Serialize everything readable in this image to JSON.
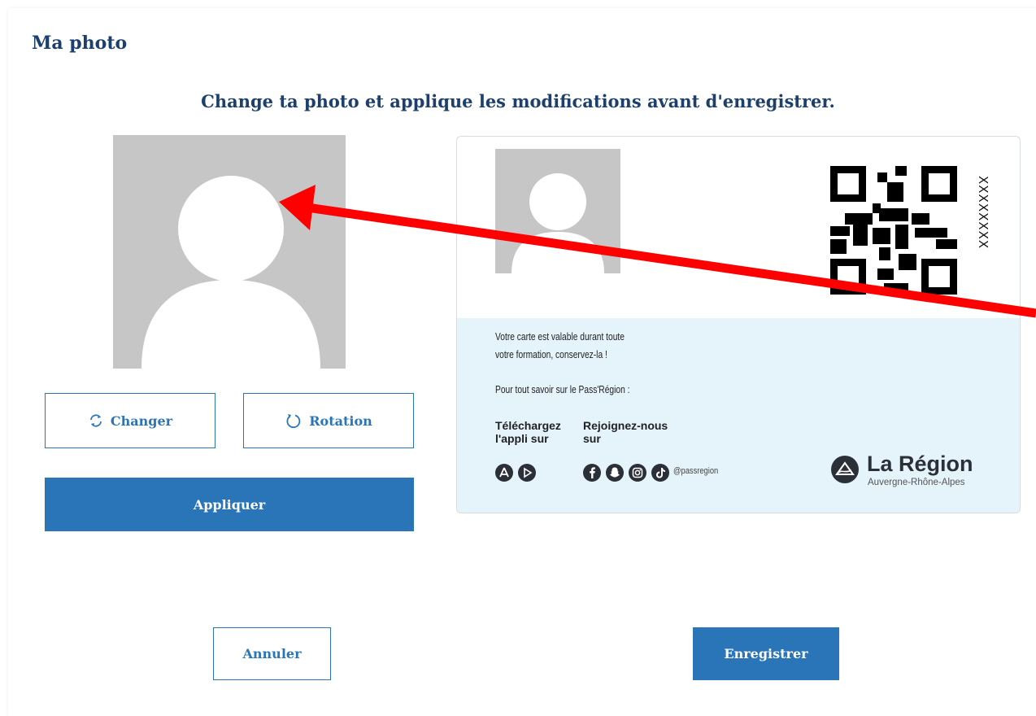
{
  "page": {
    "title": "Ma photo",
    "subtitle": "Change ta photo et applique les modifications avant d'enregistrer."
  },
  "photo_editor": {
    "change_label": "Changer",
    "rotation_label": "Rotation",
    "apply_label": "Appliquer"
  },
  "card": {
    "id_number": "XXXXXXXX",
    "validity_line1": "Votre carte est valable durant toute",
    "validity_line2": "votre formation, conservez-la !",
    "info_text": "Pour tout savoir sur le Pass'Région :",
    "download_line1": "Téléchargez",
    "download_line2": "l'appli sur",
    "join_line1": "Rejoignez-nous",
    "join_line2": "sur",
    "social_handle": "@passregion",
    "brand_name": "La Région",
    "brand_sub": "Auvergne-Rhône-Alpes"
  },
  "footer": {
    "cancel_label": "Annuler",
    "save_label": "Enregistrer"
  },
  "colors": {
    "primary": "#2a74b8",
    "title": "#1c3f6e",
    "card_bottom": "#e5f3fb",
    "placeholder": "#c6c6c6",
    "annotation_arrow": "#ff0000"
  },
  "icons": [
    "refresh-icon",
    "rotate-icon",
    "app-store-icon",
    "play-store-icon",
    "facebook-icon",
    "snapchat-icon",
    "instagram-icon",
    "tiktok-icon",
    "region-logo-icon",
    "qr-code"
  ]
}
